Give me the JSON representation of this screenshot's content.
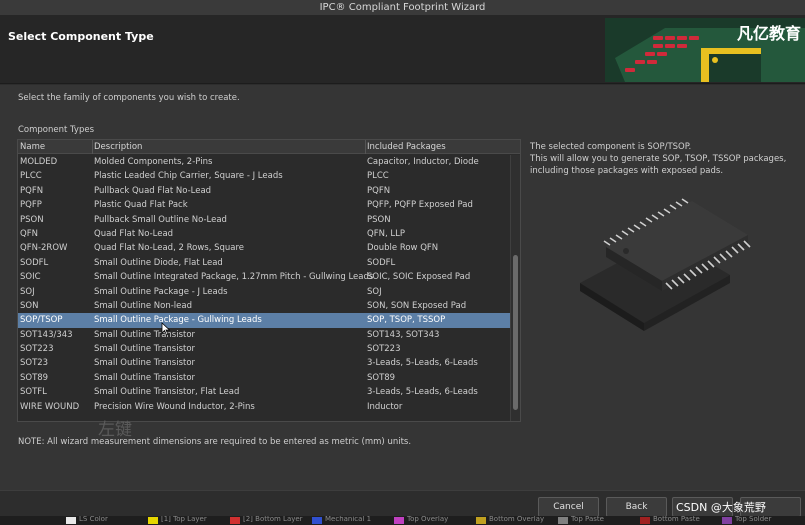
{
  "window": {
    "title": "IPC® Compliant Footprint Wizard"
  },
  "header": {
    "title": "Select Component Type",
    "watermark": "凡亿教育"
  },
  "content": {
    "instructions": "Select the family of components you wish to create.",
    "types_label": "Component Types",
    "note": "NOTE: All wizard measurement dimensions are required to be entered as metric (mm) units.",
    "overlay_text": "左键"
  },
  "table": {
    "columns": [
      "Name",
      "Description",
      "Included Packages"
    ],
    "rows": [
      {
        "name": "MOLDED",
        "desc": "Molded Components, 2-Pins",
        "pkgs": "Capacitor, Inductor, Diode"
      },
      {
        "name": "PLCC",
        "desc": "Plastic Leaded Chip Carrier, Square - J Leads",
        "pkgs": "PLCC"
      },
      {
        "name": "PQFN",
        "desc": "Pullback Quad Flat No-Lead",
        "pkgs": "PQFN"
      },
      {
        "name": "PQFP",
        "desc": "Plastic Quad Flat Pack",
        "pkgs": "PQFP, PQFP Exposed Pad"
      },
      {
        "name": "PSON",
        "desc": "Pullback Small Outline No-Lead",
        "pkgs": "PSON"
      },
      {
        "name": "QFN",
        "desc": "Quad Flat No-Lead",
        "pkgs": "QFN, LLP"
      },
      {
        "name": "QFN-2ROW",
        "desc": "Quad Flat No-Lead, 2 Rows, Square",
        "pkgs": "Double Row QFN"
      },
      {
        "name": "SODFL",
        "desc": "Small Outline Diode, Flat Lead",
        "pkgs": "SODFL"
      },
      {
        "name": "SOIC",
        "desc": "Small Outline Integrated Package, 1.27mm Pitch - Gullwing Leads",
        "pkgs": "SOIC, SOIC Exposed Pad"
      },
      {
        "name": "SOJ",
        "desc": "Small Outline Package - J Leads",
        "pkgs": "SOJ"
      },
      {
        "name": "SON",
        "desc": "Small Outline Non-lead",
        "pkgs": "SON, SON Exposed Pad"
      },
      {
        "name": "SOP/TSOP",
        "desc": "Small Outline Package - Gullwing Leads",
        "pkgs": "SOP, TSOP, TSSOP",
        "selected": true
      },
      {
        "name": "SOT143/343",
        "desc": "Small Outline Transistor",
        "pkgs": "SOT143, SOT343"
      },
      {
        "name": "SOT223",
        "desc": "Small Outline Transistor",
        "pkgs": "SOT223"
      },
      {
        "name": "SOT23",
        "desc": "Small Outline Transistor",
        "pkgs": "3-Leads, 5-Leads, 6-Leads"
      },
      {
        "name": "SOT89",
        "desc": "Small Outline Transistor",
        "pkgs": "SOT89"
      },
      {
        "name": "SOTFL",
        "desc": "Small Outline Transistor, Flat Lead",
        "pkgs": "3-Leads, 5-Leads, 6-Leads"
      },
      {
        "name": "WIRE WOUND",
        "desc": "Precision Wire Wound Inductor, 2-Pins",
        "pkgs": "Inductor"
      }
    ]
  },
  "info": {
    "line1": "The selected component is SOP/TSOP.",
    "line2": "This will allow you to generate SOP, TSOP, TSSOP packages, including those packages with exposed pads."
  },
  "footer": {
    "cancel": "Cancel",
    "back": "Back",
    "watermark": "CSDN @大象荒野"
  },
  "taskbar": {
    "items": [
      {
        "color": "#e8e8e8",
        "label": "LS Color"
      },
      {
        "color": "#e6d600",
        "label": "[1] Top Layer"
      },
      {
        "color": "#d03030",
        "label": "[2] Bottom Layer"
      },
      {
        "color": "#3050d0",
        "label": "Mechanical 1"
      },
      {
        "color": "#c040c0",
        "label": "Top Overlay"
      },
      {
        "color": "#c0a020",
        "label": "Bottom Overlay"
      },
      {
        "color": "#808080",
        "label": "Top Paste"
      },
      {
        "color": "#a02020",
        "label": "Bottom Paste"
      },
      {
        "color": "#8040a0",
        "label": "Top Solder"
      }
    ]
  },
  "colors": {
    "selection": "#5c7fa6",
    "header_bg": "#262626",
    "panel_bg": "#353535"
  }
}
